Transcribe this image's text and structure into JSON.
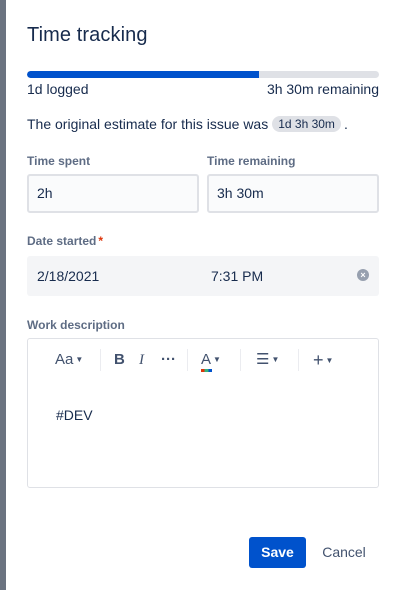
{
  "dialog": {
    "title": "Time tracking",
    "logged_label": "1d logged",
    "remaining_label": "3h 30m remaining",
    "progress_fraction": 0.66,
    "estimate_prefix": "The original estimate for this issue was",
    "estimate_value": "1d 3h 30m",
    "estimate_suffix": "."
  },
  "form": {
    "time_spent_label": "Time spent",
    "time_spent_value": "2h",
    "time_remaining_label": "Time remaining",
    "time_remaining_value": "3h 30m",
    "date_started_label": "Date started",
    "required_marker": "*",
    "date_value": "2/18/2021",
    "time_value": "7:31 PM",
    "work_description_label": "Work description",
    "work_description_text": "#DEV"
  },
  "toolbar": {
    "text_style": "Aa",
    "bold": "B",
    "italic": "I",
    "more": "···",
    "color": "A",
    "insert": "+"
  },
  "actions": {
    "save_label": "Save",
    "cancel_label": "Cancel"
  },
  "colors": {
    "primary": "#0052cc",
    "required": "#de350b"
  }
}
